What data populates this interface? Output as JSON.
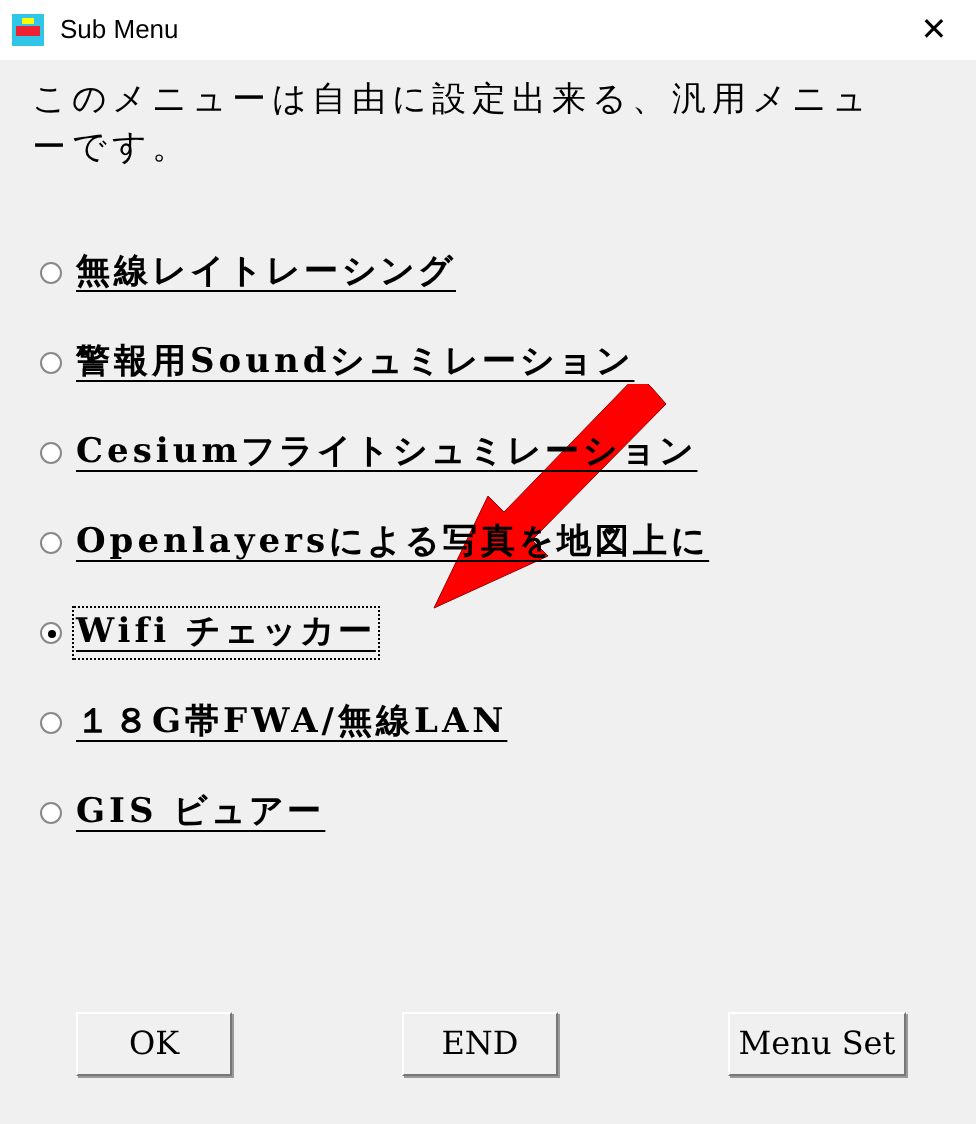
{
  "window": {
    "title": "Sub Menu",
    "close": "✕"
  },
  "description": "このメニューは自由に設定出来る、汎用メニューです。",
  "options": [
    {
      "label": "無線レイトレーシング",
      "selected": false
    },
    {
      "label": "警報用Soundシュミレーション",
      "selected": false
    },
    {
      "label": "Cesiumフライトシュミレーション",
      "selected": false
    },
    {
      "label": "Openlayersによる写真を地図上に",
      "selected": false
    },
    {
      "label": "Wifi チェッカー",
      "selected": true
    },
    {
      "label": "１８G帯FWA/無線LAN",
      "selected": false
    },
    {
      "label": "GIS ビュアー",
      "selected": false
    }
  ],
  "buttons": [
    "OK",
    "END",
    "Menu Set"
  ]
}
